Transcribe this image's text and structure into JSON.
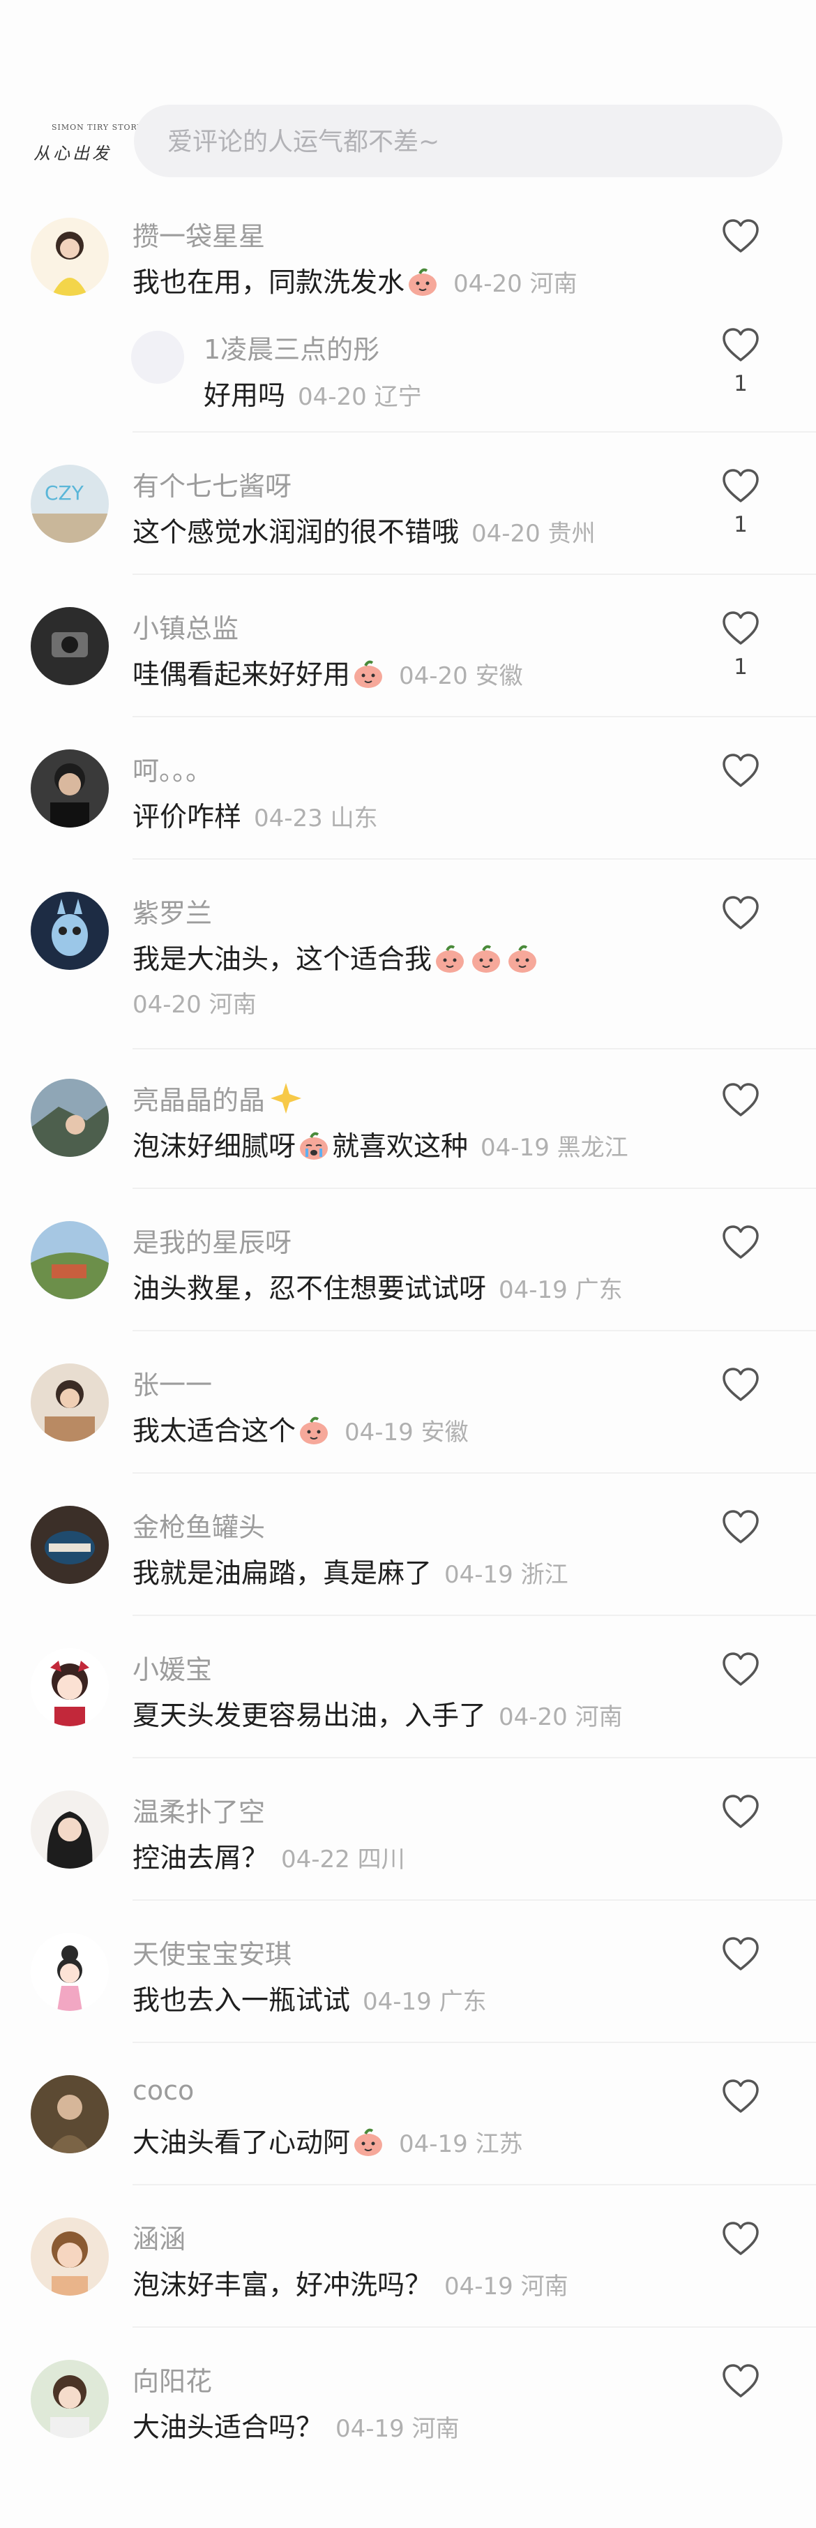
{
  "brand": {
    "tagline": "SIMON TIRY STORY",
    "name": "从心出发"
  },
  "search": {
    "placeholder": "爱评论的人运气都不差~"
  },
  "comments": [
    {
      "name": "攒一袋星星",
      "text": "我也在用，同款洗发水",
      "date": "04-20",
      "region": "河南",
      "reply": {
        "name": "1凌晨三点的彤",
        "text": "好用吗",
        "date": "04-20",
        "region": "辽宁",
        "likes": "1"
      }
    },
    {
      "name": "有个七七酱呀",
      "text": "这个感觉水润润的很不错哦",
      "date": "04-20",
      "region": "贵州",
      "likes": "1"
    },
    {
      "name": "小镇总监",
      "text": "哇偶看起来好好用",
      "date": "04-20",
      "region": "安徽",
      "likes": "1"
    },
    {
      "name": "呵。。。",
      "text": "评价咋样",
      "date": "04-23",
      "region": "山东"
    },
    {
      "name": "紫罗兰",
      "text": "我是大油头，这个适合我",
      "date": "04-20",
      "region": "河南"
    },
    {
      "name": "亮晶晶的晶",
      "text": "泡沫好细腻呀",
      "text2": "就喜欢这种",
      "date": "04-19",
      "region": "黑龙江"
    },
    {
      "name": "是我的星辰呀",
      "text": "油头救星，忍不住想要试试呀",
      "date": "04-19",
      "region": "广东"
    },
    {
      "name": "张一一",
      "text": "我太适合这个",
      "date": "04-19",
      "region": "安徽"
    },
    {
      "name": "金枪鱼罐头",
      "text": "我就是油扁踏，真是麻了",
      "date": "04-19",
      "region": "浙江"
    },
    {
      "name": "小媛宝",
      "text": "夏天头发更容易出油，入手了",
      "date": "04-20",
      "region": "河南"
    },
    {
      "name": "温柔扑了空",
      "text": "控油去屑？",
      "date": "04-22",
      "region": "四川"
    },
    {
      "name": "天使宝宝安琪",
      "text": "我也去入一瓶试试",
      "date": "04-19",
      "region": "广东"
    },
    {
      "name": "coco",
      "text": "大油头看了心动阿",
      "date": "04-19",
      "region": "江苏"
    },
    {
      "name": "涵涵",
      "text": "泡沫好丰富，好冲洗吗？",
      "date": "04-19",
      "region": "河南"
    },
    {
      "name": "向阳花",
      "text": "大油头适合吗？",
      "date": "04-19",
      "region": "河南"
    }
  ]
}
